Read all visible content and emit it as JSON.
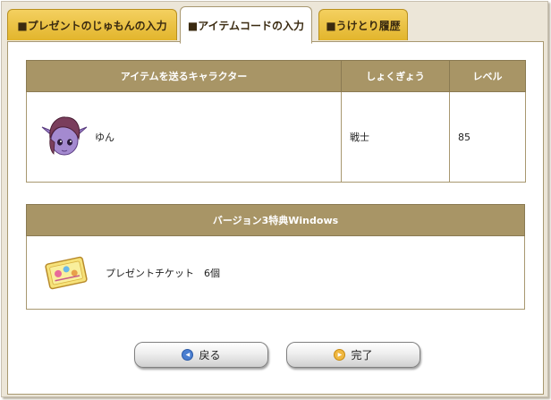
{
  "tabs": [
    {
      "label": "■プレゼントのじゅもんの入力"
    },
    {
      "label": "■アイテムコードの入力"
    },
    {
      "label": "■うけとり履歴"
    }
  ],
  "character_table": {
    "headers": [
      "アイテムを送るキャラクター",
      "しょくぎょう",
      "レベル"
    ],
    "row": {
      "name": "ゆん",
      "job": "戦士",
      "level": "85"
    }
  },
  "bonus_table": {
    "header": "バージョン3特典Windows",
    "item": "プレゼントチケット　6個"
  },
  "buttons": {
    "back": "戻る",
    "done": "完了"
  },
  "colors": {
    "tab_gold": "#e2b52c",
    "header_bg": "#a89566",
    "frame_bg": "#ece6d8"
  }
}
